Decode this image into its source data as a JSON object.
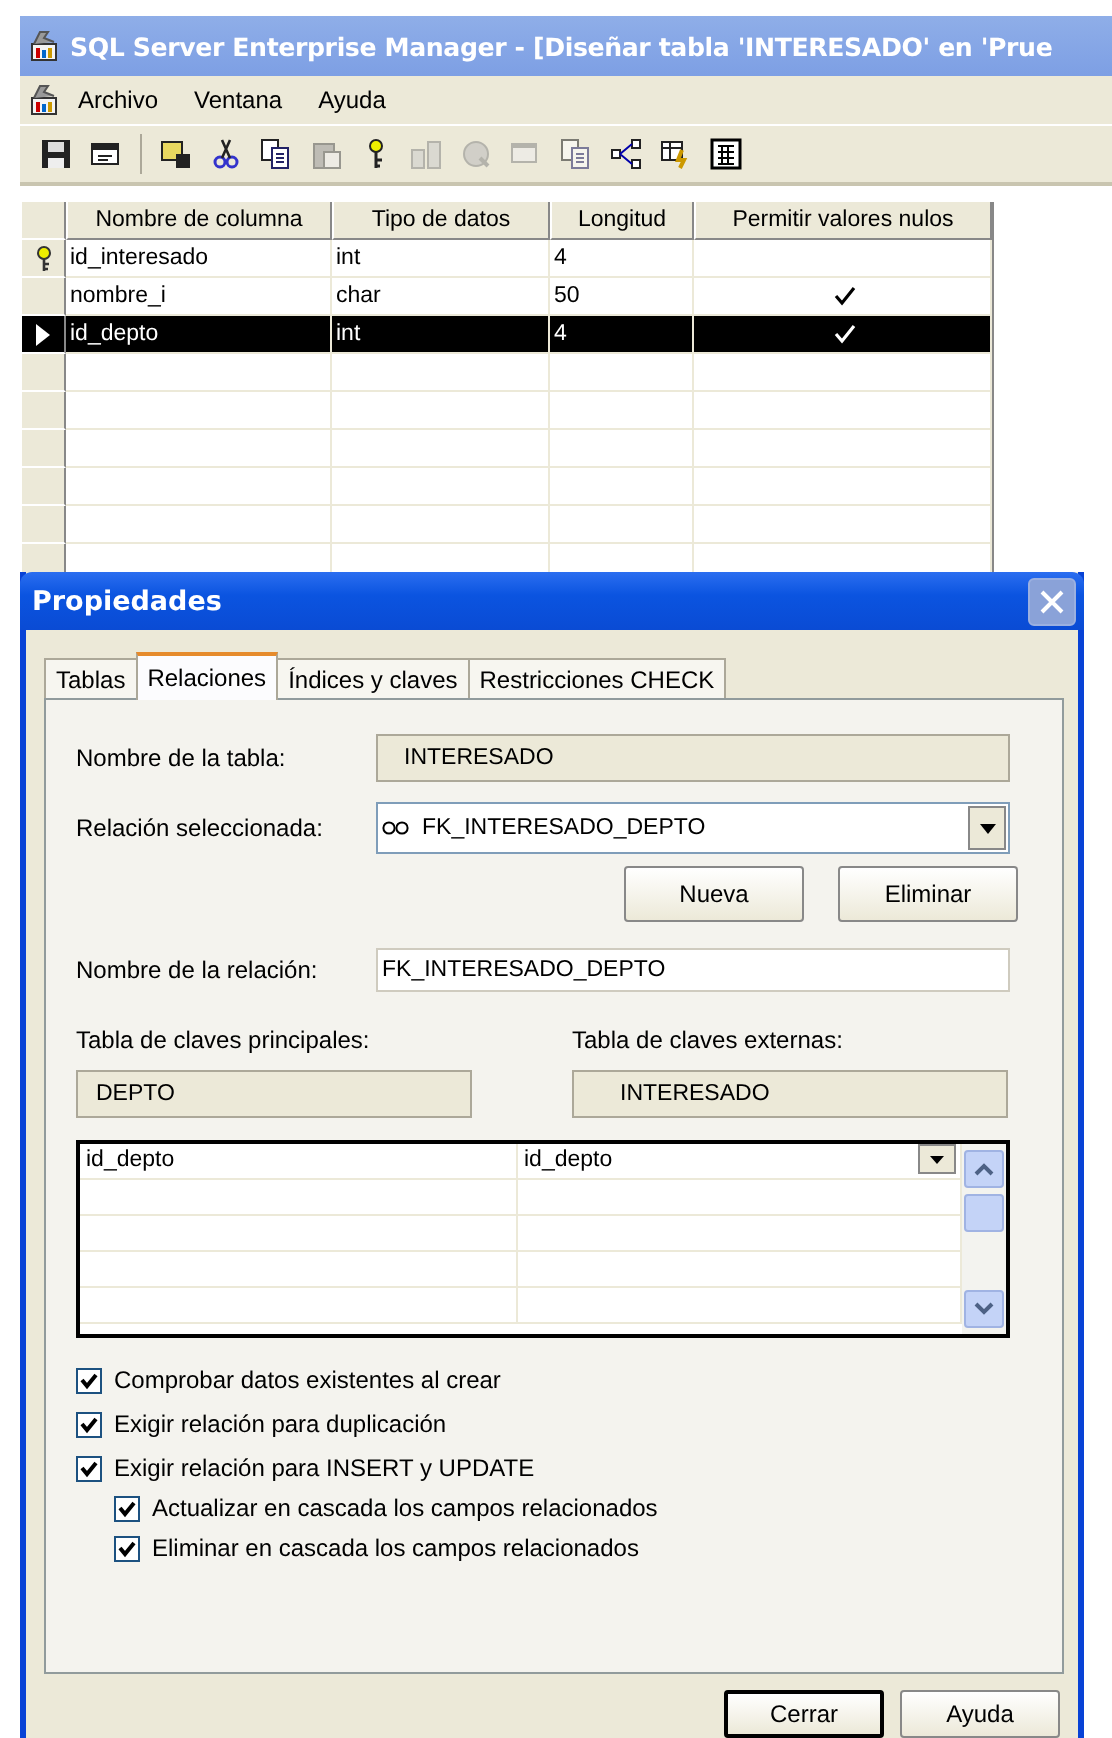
{
  "window": {
    "title": "SQL Server Enterprise Manager - [Diseñar tabla 'INTERESADO' en 'Prue"
  },
  "menu": [
    "Archivo",
    "Ventana",
    "Ayuda"
  ],
  "toolbar": [
    {
      "disabled": false
    },
    {
      "disabled": false
    },
    {
      "disabled": false
    },
    {
      "disabled": false
    },
    {
      "disabled": false
    },
    {
      "disabled": true
    },
    {
      "disabled": false
    },
    {
      "disabled": true
    },
    {
      "disabled": true
    },
    {
      "disabled": true
    },
    {
      "disabled": true
    },
    {
      "disabled": false
    },
    {
      "disabled": false
    },
    {
      "disabled": false
    }
  ],
  "table": {
    "columns": [
      "Nombre de columna",
      "Tipo de datos",
      "Longitud",
      "Permitir valores nulos"
    ],
    "rows": [
      {
        "name": "id_interesado",
        "type": "int",
        "length": "4",
        "allow_nulls": false,
        "primary_key": true,
        "selected": false
      },
      {
        "name": "nombre_i",
        "type": "char",
        "length": "50",
        "allow_nulls": true,
        "primary_key": false,
        "selected": false
      },
      {
        "name": "id_depto",
        "type": "int",
        "length": "4",
        "allow_nulls": true,
        "primary_key": false,
        "selected": true
      }
    ]
  },
  "dialog": {
    "title": "Propiedades",
    "tabs": [
      {
        "label": "Tablas",
        "selected": false
      },
      {
        "label": "Relaciones",
        "selected": true
      },
      {
        "label": "Índices y claves",
        "selected": false
      },
      {
        "label": "Restricciones CHECK",
        "selected": false
      }
    ],
    "table_name": {
      "label": "Nombre de la tabla:",
      "value": "INTERESADO"
    },
    "selected_relation": {
      "label": "Relación seleccionada:",
      "value": "FK_INTERESADO_DEPTO"
    },
    "relation_buttons": [
      "Nueva",
      "Eliminar"
    ],
    "relation_name": {
      "label": "Nombre de la relación:",
      "value": "FK_INTERESADO_DEPTO"
    },
    "primary_key_table": {
      "label": "Tabla de claves principales:",
      "value": "DEPTO"
    },
    "foreign_key_table": {
      "label": "Tabla de claves externas:",
      "value": "INTERESADO"
    },
    "key_columns": [
      {
        "primary": "id_depto",
        "foreign": "id_depto"
      }
    ],
    "options": [
      {
        "label": "Comprobar datos existentes al crear",
        "checked": true
      },
      {
        "label": "Exigir relación para duplicación",
        "checked": true
      },
      {
        "label": "Exigir relación para INSERT y UPDATE",
        "checked": true,
        "children": [
          {
            "label": "Actualizar en cascada los campos relacionados",
            "checked": true
          },
          {
            "label": "Eliminar en cascada los campos relacionados",
            "checked": true
          }
        ]
      }
    ],
    "buttons": [
      "Cerrar",
      "Ayuda"
    ]
  }
}
